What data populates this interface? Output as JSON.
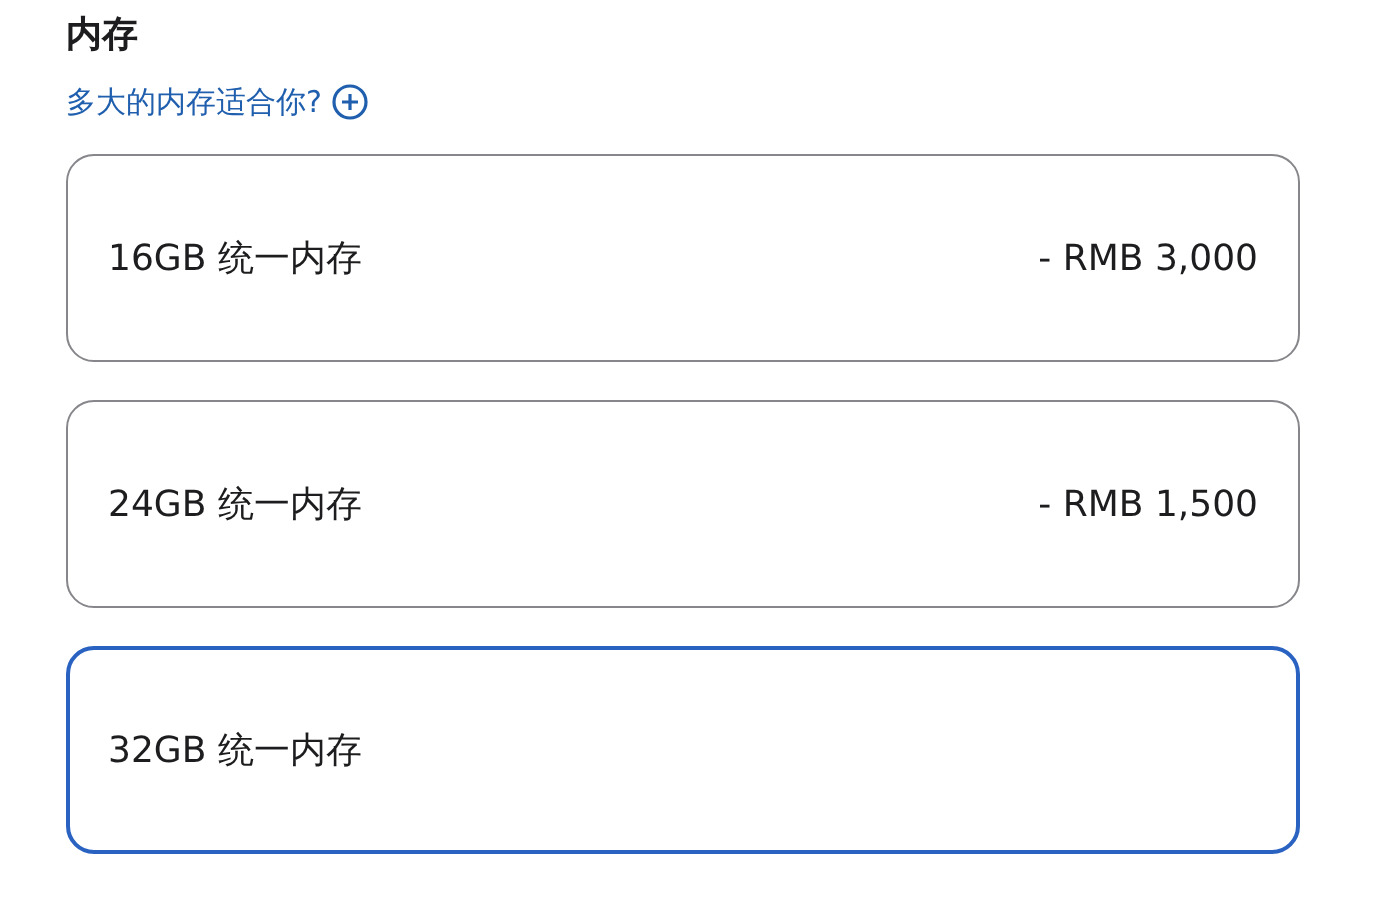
{
  "section": {
    "title": "内存",
    "help_link": "多大的内存适合你?"
  },
  "options": [
    {
      "label": "16GB 统一内存",
      "price": "- RMB 3,000",
      "selected": false
    },
    {
      "label": "24GB 统一内存",
      "price": "- RMB 1,500",
      "selected": false
    },
    {
      "label": "32GB 统一内存",
      "selected": true
    }
  ]
}
